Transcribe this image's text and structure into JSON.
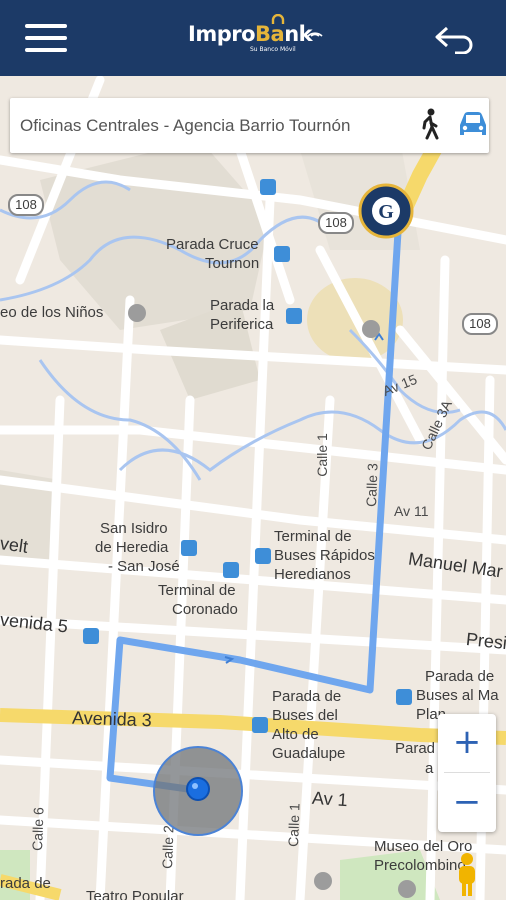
{
  "app": {
    "title_part1": "Impro",
    "title_part2": "B",
    "title_part3": "nk",
    "tagline": "Su Banco Móvil"
  },
  "route_card": {
    "destination": "Oficinas Centrales - Agencia Barrio Tournón",
    "modes": [
      "walk-icon",
      "car-icon"
    ]
  },
  "map": {
    "route_color": "#6fa6ee",
    "labels": {
      "shield_108_a": "108",
      "shield_108_b": "108",
      "shield_108_c": "108",
      "parada_cruce": "Parada Cruce",
      "tournon": "Tournon",
      "ninos": "eo de los Niños",
      "parada_la": "Parada la",
      "periferica": "Periferica",
      "av15": "Av 15",
      "calle3a": "Calle 3A",
      "calle1": "Calle 1",
      "calle3": "Calle 3",
      "av11": "Av 11",
      "san_isidro_1": "San Isidro",
      "san_isidro_2": "de Heredia",
      "san_isidro_3": "- San José",
      "terminal_1": "Terminal de",
      "terminal_2": "Buses Rápidos",
      "terminal_3": "Heredianos",
      "velt": "velt",
      "manuel": "Manuel Mar",
      "terminal_coronado_1": "Terminal de",
      "terminal_coronado_2": "Coronado",
      "avenida5": "venida 5",
      "presi": "Presi",
      "parada_de_1": "Parada de",
      "parada_de_2": "Buses al Ma",
      "parada_de_3": "Plan",
      "avenida3": "Avenida 3",
      "parada_buses_1": "Parada de",
      "parada_buses_2": "Buses del",
      "parada_buses_3": "Alto de",
      "parada_buses_4": "Guadalupe",
      "parada_r": "Parad",
      "a_r": "a",
      "av1": "Av 1",
      "calle6": "Calle 6",
      "calle2": "Calle 2",
      "calle1b": "Calle 1",
      "museo_1": "Museo del Oro",
      "museo_2": "Precolombino",
      "parada_bl": "rada de",
      "teatro": "Teatro Popular"
    }
  },
  "zoom": {
    "in_label": "+",
    "out_label": "−"
  }
}
